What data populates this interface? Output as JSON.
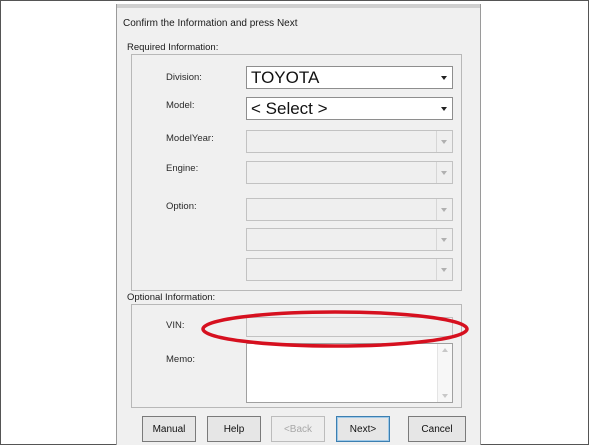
{
  "dialog": {
    "instruction": "Confirm the Information and press Next",
    "required_section": "Required Information:",
    "optional_section": "Optional Information:"
  },
  "required": {
    "division": {
      "label": "Division:",
      "value": "TOYOTA"
    },
    "model": {
      "label": "Model:",
      "value": "< Select >"
    },
    "model_year": {
      "label": "ModelYear:",
      "value": ""
    },
    "engine": {
      "label": "Engine:",
      "value": ""
    },
    "option": {
      "label": "Option:",
      "values": [
        "",
        "",
        ""
      ]
    }
  },
  "optional": {
    "vin": {
      "label": "VIN:",
      "value": ""
    },
    "memo": {
      "label": "Memo:",
      "value": ""
    }
  },
  "buttons": {
    "manual": "Manual",
    "help": "Help",
    "back": "<Back",
    "next": "Next>",
    "cancel": "Cancel"
  },
  "colors": {
    "highlight": "#d6101f",
    "dialog_bg": "#f0f0f0"
  },
  "icons": {
    "dropdown": "chevron-down-icon"
  }
}
